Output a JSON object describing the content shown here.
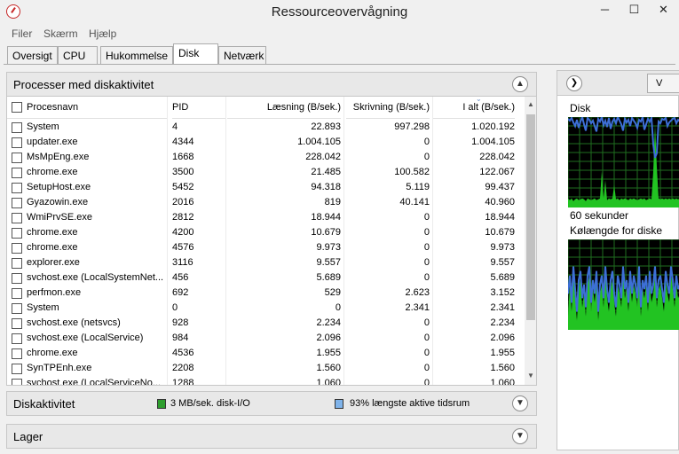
{
  "window": {
    "title": "Ressourceovervågning",
    "min_glyph": "─",
    "max_glyph": "☐",
    "close_glyph": "✕"
  },
  "menu": [
    "Filer",
    "Skærm",
    "Hjælp"
  ],
  "tabs": [
    "Oversigt",
    "CPU",
    "Hukommelse",
    "Disk",
    "Netværk"
  ],
  "active_tab": "Disk",
  "processes_section": {
    "title": "Processer med diskaktivitet",
    "columns": [
      "Procesnavn",
      "PID",
      "Læsning (B/sek.)",
      "Skrivning (B/sek.)",
      "I alt (B/sek.)"
    ],
    "rows": [
      [
        "System",
        "4",
        "22.893",
        "997.298",
        "1.020.192"
      ],
      [
        "updater.exe",
        "4344",
        "1.004.105",
        "0",
        "1.004.105"
      ],
      [
        "MsMpEng.exe",
        "1668",
        "228.042",
        "0",
        "228.042"
      ],
      [
        "chrome.exe",
        "3500",
        "21.485",
        "100.582",
        "122.067"
      ],
      [
        "SetupHost.exe",
        "5452",
        "94.318",
        "5.119",
        "99.437"
      ],
      [
        "Gyazowin.exe",
        "2016",
        "819",
        "40.141",
        "40.960"
      ],
      [
        "WmiPrvSE.exe",
        "2812",
        "18.944",
        "0",
        "18.944"
      ],
      [
        "chrome.exe",
        "4200",
        "10.679",
        "0",
        "10.679"
      ],
      [
        "chrome.exe",
        "4576",
        "9.973",
        "0",
        "9.973"
      ],
      [
        "explorer.exe",
        "3116",
        "9.557",
        "0",
        "9.557"
      ],
      [
        "svchost.exe (LocalSystemNet...",
        "456",
        "5.689",
        "0",
        "5.689"
      ],
      [
        "perfmon.exe",
        "692",
        "529",
        "2.623",
        "3.152"
      ],
      [
        "System",
        "0",
        "0",
        "2.341",
        "2.341"
      ],
      [
        "svchost.exe (netsvcs)",
        "928",
        "2.234",
        "0",
        "2.234"
      ],
      [
        "svchost.exe (LocalService)",
        "984",
        "2.096",
        "0",
        "2.096"
      ],
      [
        "chrome.exe",
        "4536",
        "1.955",
        "0",
        "1.955"
      ],
      [
        "SynTPEnh.exe",
        "2208",
        "1.560",
        "0",
        "1.560"
      ],
      [
        "svchost.exe (LocalServiceNo...",
        "1288",
        "1.060",
        "0",
        "1.060"
      ]
    ]
  },
  "disk_activity": {
    "title": "Diskaktivitet",
    "io_text": "3 MB/sek. disk-I/O",
    "active_text": "93% længste aktive tidsrum",
    "io_color": "#2e9e2e",
    "active_color": "#7fb3ea"
  },
  "storage": {
    "title": "Lager"
  },
  "right_panel": {
    "expand_glyph": "❯",
    "view_label": "V",
    "graph1_label": "Disk",
    "time_label": "60 sekunder",
    "graph2_label": "Kølængde for diske"
  },
  "colors": {
    "graph_bg": "#000000",
    "graph_grid": "#1f6e1f",
    "graph_green": "#22c322",
    "graph_blue": "#3d6fd6"
  }
}
